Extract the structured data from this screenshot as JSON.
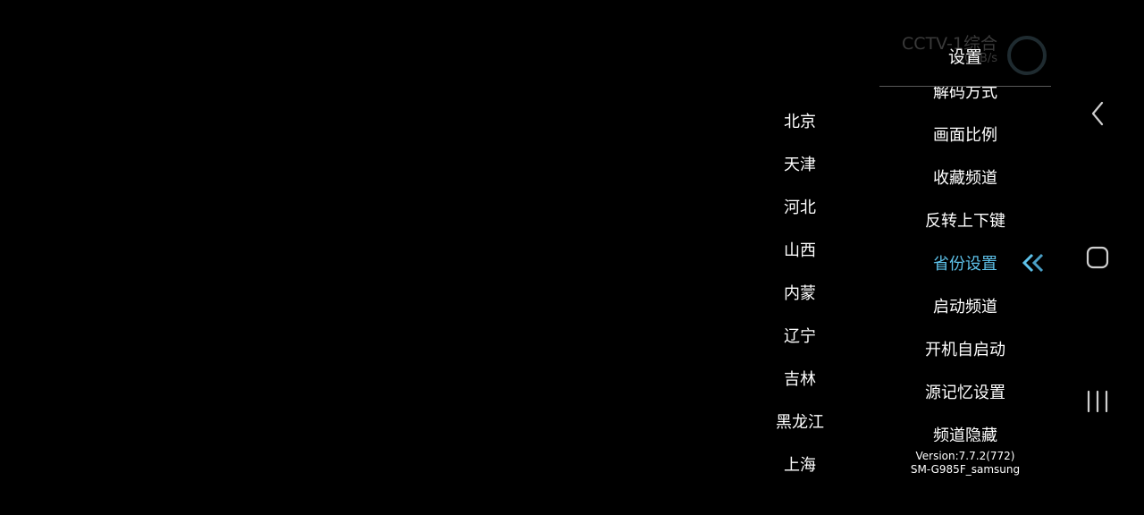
{
  "overlay": {
    "channel_name": "CCTV-1综合",
    "speed": "0.0KB/s"
  },
  "settings": {
    "title": "设置",
    "items": [
      {
        "label": "解码方式"
      },
      {
        "label": "画面比例"
      },
      {
        "label": "收藏频道"
      },
      {
        "label": "反转上下键"
      },
      {
        "label": "省份设置"
      },
      {
        "label": "启动频道"
      },
      {
        "label": "开机自启动"
      },
      {
        "label": "源记忆设置"
      },
      {
        "label": "频道隐藏"
      }
    ],
    "selected_index": 4,
    "version": "Version:7.7.2(772)",
    "device": "SM-G985F_samsung"
  },
  "provinces": [
    "北京",
    "天津",
    "河北",
    "山西",
    "内蒙",
    "辽宁",
    "吉林",
    "黑龙江",
    "上海"
  ],
  "colors": {
    "background": "#000000",
    "text": "#ffffff",
    "accent": "#5ec2ea"
  },
  "nav_bar": {
    "back": "back-icon",
    "home": "home-icon",
    "recents": "recents-icon"
  }
}
